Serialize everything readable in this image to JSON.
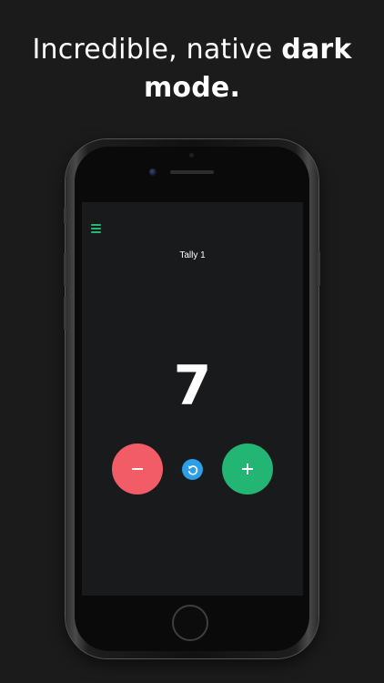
{
  "headline": {
    "line1_regular": "Incredible, native ",
    "line1_bold": "dark",
    "line2_bold": "mode."
  },
  "app": {
    "tally_title": "Tally 1",
    "count": "7",
    "decrement_symbol": "–",
    "increment_symbol": "+"
  },
  "colors": {
    "accent_green": "#22b573",
    "menu_green": "#2bb673",
    "decrement_red": "#f25c66",
    "reset_blue": "#2d9ee8",
    "screen_background": "#181a1c",
    "page_background": "#1b1b1b"
  },
  "icons": {
    "menu": "hamburger-menu-icon",
    "reset": "reset-arrow-icon",
    "minus": "minus-icon",
    "plus": "plus-icon"
  }
}
